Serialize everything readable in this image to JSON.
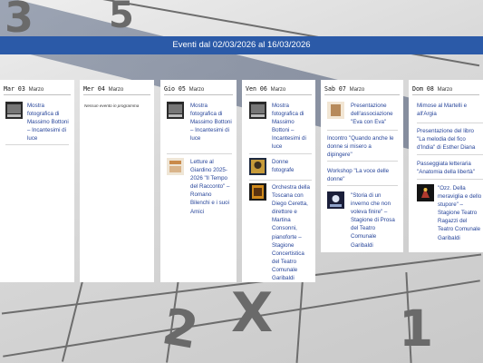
{
  "header": {
    "title": "Eventi dal 02/03/2026 al 16/03/2026"
  },
  "days": [
    {
      "name": "Mar 03",
      "month": "Marzo",
      "events": [
        {
          "title": "Mostra fotografica di Massimo Bottoni – Incantesimi di luce",
          "thumb": "exhibition-thumbnail"
        }
      ]
    },
    {
      "name": "Mer 04",
      "month": "Marzo",
      "empty": "Nessun evento in programma",
      "events": []
    },
    {
      "name": "Gio 05",
      "month": "Marzo",
      "events": [
        {
          "title": "Mostra fotografica di Massimo Bottoni – Incantesimi di luce",
          "thumb": "exhibition-thumbnail"
        },
        {
          "title": "Letture al Giardino 2025-2026 \"Il Tempo del Racconto\" – Romano Bilenchi e i suoi Amici",
          "thumb": "reading-thumbnail"
        }
      ]
    },
    {
      "name": "Ven 06",
      "month": "Marzo",
      "events": [
        {
          "title": "Mostra fotografica di Massimo Bottoni – Incantesimi di luce",
          "thumb": "exhibition-thumbnail"
        },
        {
          "title": "Donne fotografe",
          "thumb": "photo-thumbnail"
        },
        {
          "title": "Orchestra della Toscana con Diego Ceretta, direttore e Martina Consonni, pianoforte – Stagione Concertistica del Teatro Comunale Garibaldi",
          "thumb": "concert-thumbnail"
        }
      ]
    },
    {
      "name": "Sab 07",
      "month": "Marzo",
      "events": [
        {
          "title": "Presentazione dell'associazione \"Eva con Eva\"",
          "thumb": "association-thumbnail"
        },
        {
          "title": "Incontro \"Quando anche le donne si misero a dipingere\""
        },
        {
          "title": "Workshop \"La voce delle donne\""
        },
        {
          "title": "\"Storia di un inverno che non voleva finire\" – Stagione di Prosa del Teatro Comunale Garibaldi",
          "thumb": "theatre-thumbnail"
        }
      ]
    },
    {
      "name": "Dom 08",
      "month": "Marzo",
      "events": [
        {
          "title": "Mimose al Martelli e all'Argia"
        },
        {
          "title": "Presentazione del libro \"La melodia del fico d'India\" di Esther Diana"
        },
        {
          "title": "Passeggiata letteraria \"Anatomia della libertà\""
        },
        {
          "title": "\"Ozz. Della meraviglia e dello stupore\" – Stagione Teatro Ragazzi del Teatro Comunale Garibaldi",
          "thumb": "kids-theatre-thumbnail"
        }
      ]
    }
  ]
}
